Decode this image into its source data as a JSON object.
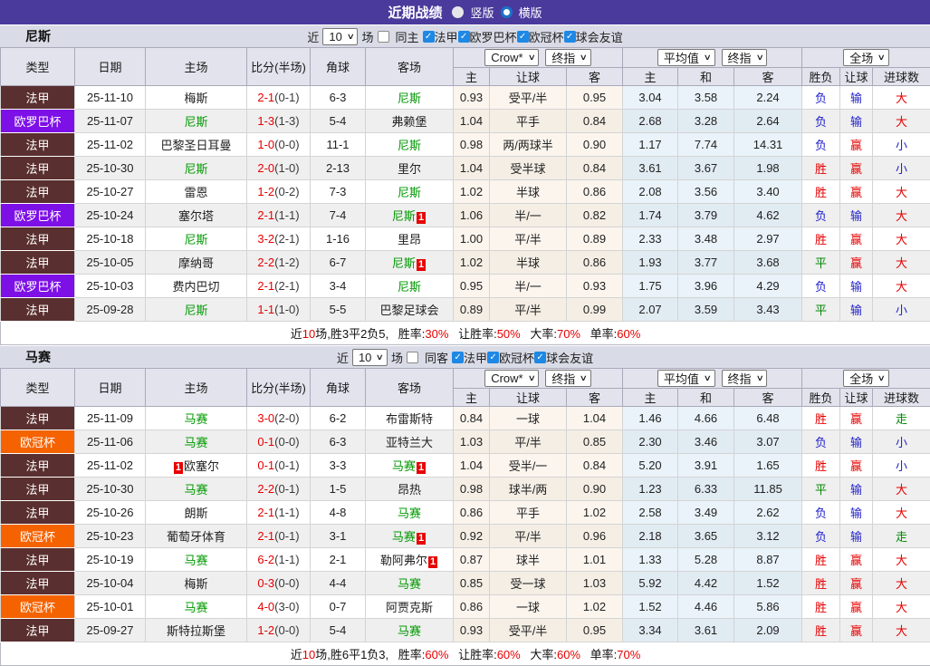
{
  "topbar": {
    "title": "近期战绩",
    "vertical_label": "竖版",
    "horizontal_label": "横版"
  },
  "filter_labels": {
    "near": "近",
    "count": "10",
    "matches": "场"
  },
  "selects": {
    "company": "Crow*",
    "final": "终指",
    "average": "平均值",
    "final2": "终指",
    "scope": "全场"
  },
  "columns": {
    "type": "类型",
    "date": "日期",
    "home": "主场",
    "score": "比分(半场)",
    "corner": "角球",
    "away": "客场",
    "odds_home": "主",
    "odds_handicap": "让球",
    "odds_away": "客",
    "avg_home": "主",
    "avg_draw": "和",
    "avg_away": "客",
    "result_wdl": "胜负",
    "result_handicap": "让球",
    "result_goals": "进球数"
  },
  "colors": {
    "topbar_bg": "#4a3a9c",
    "score_red": "#e60000",
    "focus_team": "#009900",
    "badge_bg": "#e60000",
    "checkbox_blue": "#1e88e5"
  },
  "league_colors": {
    "法甲": "#5a2f2f",
    "欧罗巴杯": "#7d10e6",
    "欧冠杯": "#f56300"
  },
  "tone_colors": {
    "r": "#e60000",
    "b": "#2222cc",
    "g": "#008800"
  },
  "sections": [
    {
      "team": "尼斯",
      "same_venue_label": "同主",
      "leagues": [
        "法甲",
        "欧罗巴杯",
        "欧冠杯",
        "球会友谊"
      ],
      "rows": [
        {
          "league": "法甲",
          "date": "25-11-10",
          "home": "梅斯",
          "home_focus": false,
          "home_badge": "",
          "home_badge_before": false,
          "score_ft": "2-1",
          "score_ht": "(0-1)",
          "corner": "6-3",
          "away": "尼斯",
          "away_focus": true,
          "away_badge": "",
          "odds": [
            "0.93",
            "受平/半",
            "0.95"
          ],
          "avg": [
            "3.04",
            "3.58",
            "2.24"
          ],
          "results": [
            [
              "负",
              "b"
            ],
            [
              "输",
              "b"
            ],
            [
              "大",
              "r"
            ]
          ]
        },
        {
          "league": "欧罗巴杯",
          "date": "25-11-07",
          "home": "尼斯",
          "home_focus": true,
          "home_badge": "",
          "home_badge_before": false,
          "score_ft": "1-3",
          "score_ht": "(1-3)",
          "corner": "5-4",
          "away": "弗赖堡",
          "away_focus": false,
          "away_badge": "",
          "odds": [
            "1.04",
            "平手",
            "0.84"
          ],
          "avg": [
            "2.68",
            "3.28",
            "2.64"
          ],
          "results": [
            [
              "负",
              "b"
            ],
            [
              "输",
              "b"
            ],
            [
              "大",
              "r"
            ]
          ]
        },
        {
          "league": "法甲",
          "date": "25-11-02",
          "home": "巴黎圣日耳曼",
          "home_focus": false,
          "home_badge": "",
          "home_badge_before": false,
          "score_ft": "1-0",
          "score_ht": "(0-0)",
          "corner": "11-1",
          "away": "尼斯",
          "away_focus": true,
          "away_badge": "",
          "odds": [
            "0.98",
            "两/两球半",
            "0.90"
          ],
          "avg": [
            "1.17",
            "7.74",
            "14.31"
          ],
          "results": [
            [
              "负",
              "b"
            ],
            [
              "赢",
              "r"
            ],
            [
              "小",
              "b"
            ]
          ]
        },
        {
          "league": "法甲",
          "date": "25-10-30",
          "home": "尼斯",
          "home_focus": true,
          "home_badge": "",
          "home_badge_before": false,
          "score_ft": "2-0",
          "score_ht": "(1-0)",
          "corner": "2-13",
          "away": "里尔",
          "away_focus": false,
          "away_badge": "",
          "odds": [
            "1.04",
            "受半球",
            "0.84"
          ],
          "avg": [
            "3.61",
            "3.67",
            "1.98"
          ],
          "results": [
            [
              "胜",
              "r"
            ],
            [
              "赢",
              "r"
            ],
            [
              "小",
              "b"
            ]
          ]
        },
        {
          "league": "法甲",
          "date": "25-10-27",
          "home": "雷恩",
          "home_focus": false,
          "home_badge": "",
          "home_badge_before": false,
          "score_ft": "1-2",
          "score_ht": "(0-2)",
          "corner": "7-3",
          "away": "尼斯",
          "away_focus": true,
          "away_badge": "",
          "odds": [
            "1.02",
            "半球",
            "0.86"
          ],
          "avg": [
            "2.08",
            "3.56",
            "3.40"
          ],
          "results": [
            [
              "胜",
              "r"
            ],
            [
              "赢",
              "r"
            ],
            [
              "大",
              "r"
            ]
          ]
        },
        {
          "league": "欧罗巴杯",
          "date": "25-10-24",
          "home": "塞尔塔",
          "home_focus": false,
          "home_badge": "",
          "home_badge_before": false,
          "score_ft": "2-1",
          "score_ht": "(1-1)",
          "corner": "7-4",
          "away": "尼斯",
          "away_focus": true,
          "away_badge": "1",
          "odds": [
            "1.06",
            "半/一",
            "0.82"
          ],
          "avg": [
            "1.74",
            "3.79",
            "4.62"
          ],
          "results": [
            [
              "负",
              "b"
            ],
            [
              "输",
              "b"
            ],
            [
              "大",
              "r"
            ]
          ]
        },
        {
          "league": "法甲",
          "date": "25-10-18",
          "home": "尼斯",
          "home_focus": true,
          "home_badge": "",
          "home_badge_before": false,
          "score_ft": "3-2",
          "score_ht": "(2-1)",
          "corner": "1-16",
          "away": "里昂",
          "away_focus": false,
          "away_badge": "",
          "odds": [
            "1.00",
            "平/半",
            "0.89"
          ],
          "avg": [
            "2.33",
            "3.48",
            "2.97"
          ],
          "results": [
            [
              "胜",
              "r"
            ],
            [
              "赢",
              "r"
            ],
            [
              "大",
              "r"
            ]
          ]
        },
        {
          "league": "法甲",
          "date": "25-10-05",
          "home": "摩纳哥",
          "home_focus": false,
          "home_badge": "",
          "home_badge_before": false,
          "score_ft": "2-2",
          "score_ht": "(1-2)",
          "corner": "6-7",
          "away": "尼斯",
          "away_focus": true,
          "away_badge": "1",
          "odds": [
            "1.02",
            "半球",
            "0.86"
          ],
          "avg": [
            "1.93",
            "3.77",
            "3.68"
          ],
          "results": [
            [
              "平",
              "g"
            ],
            [
              "赢",
              "r"
            ],
            [
              "大",
              "r"
            ]
          ]
        },
        {
          "league": "欧罗巴杯",
          "date": "25-10-03",
          "home": "费内巴切",
          "home_focus": false,
          "home_badge": "",
          "home_badge_before": false,
          "score_ft": "2-1",
          "score_ht": "(2-1)",
          "corner": "3-4",
          "away": "尼斯",
          "away_focus": true,
          "away_badge": "",
          "odds": [
            "0.95",
            "半/一",
            "0.93"
          ],
          "avg": [
            "1.75",
            "3.96",
            "4.29"
          ],
          "results": [
            [
              "负",
              "b"
            ],
            [
              "输",
              "b"
            ],
            [
              "大",
              "r"
            ]
          ]
        },
        {
          "league": "法甲",
          "date": "25-09-28",
          "home": "尼斯",
          "home_focus": true,
          "home_badge": "",
          "home_badge_before": false,
          "score_ft": "1-1",
          "score_ht": "(1-0)",
          "corner": "5-5",
          "away": "巴黎足球会",
          "away_focus": false,
          "away_badge": "",
          "odds": [
            "0.89",
            "平/半",
            "0.99"
          ],
          "avg": [
            "2.07",
            "3.59",
            "3.43"
          ],
          "results": [
            [
              "平",
              "g"
            ],
            [
              "输",
              "b"
            ],
            [
              "小",
              "b"
            ]
          ]
        }
      ],
      "summary": {
        "prefix": "近",
        "count": "10",
        "record": "场,胜3平2负5,",
        "stats": [
          {
            "label": "胜率:",
            "value": "30%"
          },
          {
            "label": "让胜率:",
            "value": "50%"
          },
          {
            "label": "大率:",
            "value": "70%"
          },
          {
            "label": "单率:",
            "value": "60%"
          }
        ]
      }
    },
    {
      "team": "马赛",
      "same_venue_label": "同客",
      "leagues": [
        "法甲",
        "欧冠杯",
        "球会友谊"
      ],
      "rows": [
        {
          "league": "法甲",
          "date": "25-11-09",
          "home": "马赛",
          "home_focus": true,
          "home_badge": "",
          "home_badge_before": false,
          "score_ft": "3-0",
          "score_ht": "(2-0)",
          "corner": "6-2",
          "away": "布雷斯特",
          "away_focus": false,
          "away_badge": "",
          "odds": [
            "0.84",
            "一球",
            "1.04"
          ],
          "avg": [
            "1.46",
            "4.66",
            "6.48"
          ],
          "results": [
            [
              "胜",
              "r"
            ],
            [
              "赢",
              "r"
            ],
            [
              "走",
              "g"
            ]
          ]
        },
        {
          "league": "欧冠杯",
          "date": "25-11-06",
          "home": "马赛",
          "home_focus": true,
          "home_badge": "",
          "home_badge_before": false,
          "score_ft": "0-1",
          "score_ht": "(0-0)",
          "corner": "6-3",
          "away": "亚特兰大",
          "away_focus": false,
          "away_badge": "",
          "odds": [
            "1.03",
            "平/半",
            "0.85"
          ],
          "avg": [
            "2.30",
            "3.46",
            "3.07"
          ],
          "results": [
            [
              "负",
              "b"
            ],
            [
              "输",
              "b"
            ],
            [
              "小",
              "b"
            ]
          ]
        },
        {
          "league": "法甲",
          "date": "25-11-02",
          "home": "欧塞尔",
          "home_focus": false,
          "home_badge": "1",
          "home_badge_before": true,
          "score_ft": "0-1",
          "score_ht": "(0-1)",
          "corner": "3-3",
          "away": "马赛",
          "away_focus": true,
          "away_badge": "1",
          "odds": [
            "1.04",
            "受半/一",
            "0.84"
          ],
          "avg": [
            "5.20",
            "3.91",
            "1.65"
          ],
          "results": [
            [
              "胜",
              "r"
            ],
            [
              "赢",
              "r"
            ],
            [
              "小",
              "b"
            ]
          ]
        },
        {
          "league": "法甲",
          "date": "25-10-30",
          "home": "马赛",
          "home_focus": true,
          "home_badge": "",
          "home_badge_before": false,
          "score_ft": "2-2",
          "score_ht": "(0-1)",
          "corner": "1-5",
          "away": "昂热",
          "away_focus": false,
          "away_badge": "",
          "odds": [
            "0.98",
            "球半/两",
            "0.90"
          ],
          "avg": [
            "1.23",
            "6.33",
            "11.85"
          ],
          "results": [
            [
              "平",
              "g"
            ],
            [
              "输",
              "b"
            ],
            [
              "大",
              "r"
            ]
          ]
        },
        {
          "league": "法甲",
          "date": "25-10-26",
          "home": "朗斯",
          "home_focus": false,
          "home_badge": "",
          "home_badge_before": false,
          "score_ft": "2-1",
          "score_ht": "(1-1)",
          "corner": "4-8",
          "away": "马赛",
          "away_focus": true,
          "away_badge": "",
          "odds": [
            "0.86",
            "平手",
            "1.02"
          ],
          "avg": [
            "2.58",
            "3.49",
            "2.62"
          ],
          "results": [
            [
              "负",
              "b"
            ],
            [
              "输",
              "b"
            ],
            [
              "大",
              "r"
            ]
          ]
        },
        {
          "league": "欧冠杯",
          "date": "25-10-23",
          "home": "葡萄牙体育",
          "home_focus": false,
          "home_badge": "",
          "home_badge_before": false,
          "score_ft": "2-1",
          "score_ht": "(0-1)",
          "corner": "3-1",
          "away": "马赛",
          "away_focus": true,
          "away_badge": "1",
          "odds": [
            "0.92",
            "平/半",
            "0.96"
          ],
          "avg": [
            "2.18",
            "3.65",
            "3.12"
          ],
          "results": [
            [
              "负",
              "b"
            ],
            [
              "输",
              "b"
            ],
            [
              "走",
              "g"
            ]
          ]
        },
        {
          "league": "法甲",
          "date": "25-10-19",
          "home": "马赛",
          "home_focus": true,
          "home_badge": "",
          "home_badge_before": false,
          "score_ft": "6-2",
          "score_ht": "(1-1)",
          "corner": "2-1",
          "away": "勒阿弗尔",
          "away_focus": false,
          "away_badge": "1",
          "odds": [
            "0.87",
            "球半",
            "1.01"
          ],
          "avg": [
            "1.33",
            "5.28",
            "8.87"
          ],
          "results": [
            [
              "胜",
              "r"
            ],
            [
              "赢",
              "r"
            ],
            [
              "大",
              "r"
            ]
          ]
        },
        {
          "league": "法甲",
          "date": "25-10-04",
          "home": "梅斯",
          "home_focus": false,
          "home_badge": "",
          "home_badge_before": false,
          "score_ft": "0-3",
          "score_ht": "(0-0)",
          "corner": "4-4",
          "away": "马赛",
          "away_focus": true,
          "away_badge": "",
          "odds": [
            "0.85",
            "受一球",
            "1.03"
          ],
          "avg": [
            "5.92",
            "4.42",
            "1.52"
          ],
          "results": [
            [
              "胜",
              "r"
            ],
            [
              "赢",
              "r"
            ],
            [
              "大",
              "r"
            ]
          ]
        },
        {
          "league": "欧冠杯",
          "date": "25-10-01",
          "home": "马赛",
          "home_focus": true,
          "home_badge": "",
          "home_badge_before": false,
          "score_ft": "4-0",
          "score_ht": "(3-0)",
          "corner": "0-7",
          "away": "阿贾克斯",
          "away_focus": false,
          "away_badge": "",
          "odds": [
            "0.86",
            "一球",
            "1.02"
          ],
          "avg": [
            "1.52",
            "4.46",
            "5.86"
          ],
          "results": [
            [
              "胜",
              "r"
            ],
            [
              "赢",
              "r"
            ],
            [
              "大",
              "r"
            ]
          ]
        },
        {
          "league": "法甲",
          "date": "25-09-27",
          "home": "斯特拉斯堡",
          "home_focus": false,
          "home_badge": "",
          "home_badge_before": false,
          "score_ft": "1-2",
          "score_ht": "(0-0)",
          "corner": "5-4",
          "away": "马赛",
          "away_focus": true,
          "away_badge": "",
          "odds": [
            "0.93",
            "受平/半",
            "0.95"
          ],
          "avg": [
            "3.34",
            "3.61",
            "2.09"
          ],
          "results": [
            [
              "胜",
              "r"
            ],
            [
              "赢",
              "r"
            ],
            [
              "大",
              "r"
            ]
          ]
        }
      ],
      "summary": {
        "prefix": "近",
        "count": "10",
        "record": "场,胜6平1负3,",
        "stats": [
          {
            "label": "胜率:",
            "value": "60%"
          },
          {
            "label": "让胜率:",
            "value": "60%"
          },
          {
            "label": "大率:",
            "value": "60%"
          },
          {
            "label": "单率:",
            "value": "70%"
          }
        ]
      }
    }
  ]
}
